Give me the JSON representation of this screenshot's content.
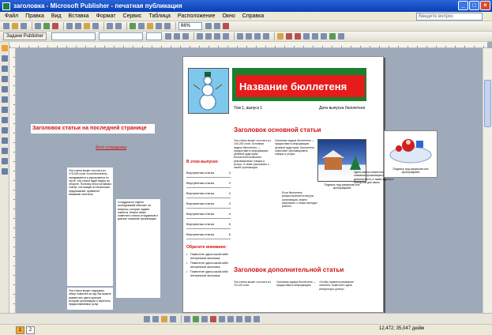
{
  "window": {
    "title": "заголовка - Microsoft Publisher - печатная публикация",
    "min": "_",
    "max": "□",
    "close": "×"
  },
  "menu": [
    "Файл",
    "Правка",
    "Вид",
    "Вставка",
    "Формат",
    "Сервис",
    "Таблица",
    "Расположение",
    "Окно",
    "Справка"
  ],
  "help_box": "Введите вопрос",
  "toolbar": {
    "tasks": "Задачи Publisher",
    "zoom": "66%"
  },
  "page": {
    "banner_title": "Название бюллетеня",
    "sub_left": "Том 1, выпуск 1",
    "sub_right": "Дата выпуска бюллетеня",
    "main_head": "Заголовок основной статьи",
    "sec_head": "Заголовок дополнительной статьи",
    "in_issue": "В этом выпуске:",
    "toc": [
      {
        "label": "Внутренняя статья",
        "num": "2"
      },
      {
        "label": "Внутренняя статья",
        "num": "2"
      },
      {
        "label": "Внутренняя статья",
        "num": "2"
      },
      {
        "label": "Внутренняя статья",
        "num": "3"
      },
      {
        "label": "Внутренняя статья",
        "num": "4"
      },
      {
        "label": "Внутренняя статья",
        "num": "5"
      },
      {
        "label": "Внутренняя статья",
        "num": "6"
      }
    ],
    "special": "Обратите внимание:",
    "bullets": [
      "Поместите здесь какой-либо интересный заголовок.",
      "Поместите здесь какой-либо интересный заголовок.",
      "Поместите здесь какой-либо интересный заголовок."
    ],
    "house_caption": "Подпись под рисунком или фотографией",
    "col1": "Эта статья может состоять из 100-200 слов. Основная задача бюллетеня — предоставить информацию целевой аудитории. Бюллетени позволяют рекламировать товары и услуги, а также рассказать о своей организации.",
    "col2": "Основная задача бюллетеня — предоставить информацию целевой аудитории. Бюллетени позволяют рекламировать товары и услуги.",
    "col3": "Если бюллетень распространяется внутри организации, можно рассказать о новых методах работы.",
    "sec_col1": "Эта статья может состоять из 75-125 слов.",
    "sec_col2": "Основная задача бюллетеня — предоставить информацию.",
    "sec_col3": "«Чтобы привлечь внимание читателя, поместите здесь интересную цитату»"
  },
  "floating": {
    "head": "Заголовок статьи на последней странице",
    "sub": "Фото сотрудника",
    "col1": "Эта статья может состоять из 175-225 слов. Если бюллетень складывается и рассылается по почте, эта статья будет видна на обороте. Поэтому легко читаемая статья, состоящая из нескольких предложений, привлечёт внимание читателя.",
    "col2": "Сотрудник из отдела исследований отвечает на вопросы, которые задают клиенты. Можно также поместить список сотрудников и краткое описание организации.",
    "col3": "Эта статья может содержать обзор новостей за год. Вы можете разместить здесь краткую историю организации и перечень предоставляемых услуг.",
    "side_text": "Здесь можно поместить краткое описание организации и её деятельности, а также адреса и телефоны для связи.",
    "santa_caption": "Подпись под рисунком или фотографией"
  },
  "status": {
    "pages": [
      "1",
      "2"
    ],
    "coords": "12,472; 35,047 дюйм"
  },
  "colors": {
    "banner_green": "#1a7f2e",
    "banner_red": "#e61b1b",
    "heading_red": "#d01212",
    "title_blue": "#0a3fb6"
  }
}
